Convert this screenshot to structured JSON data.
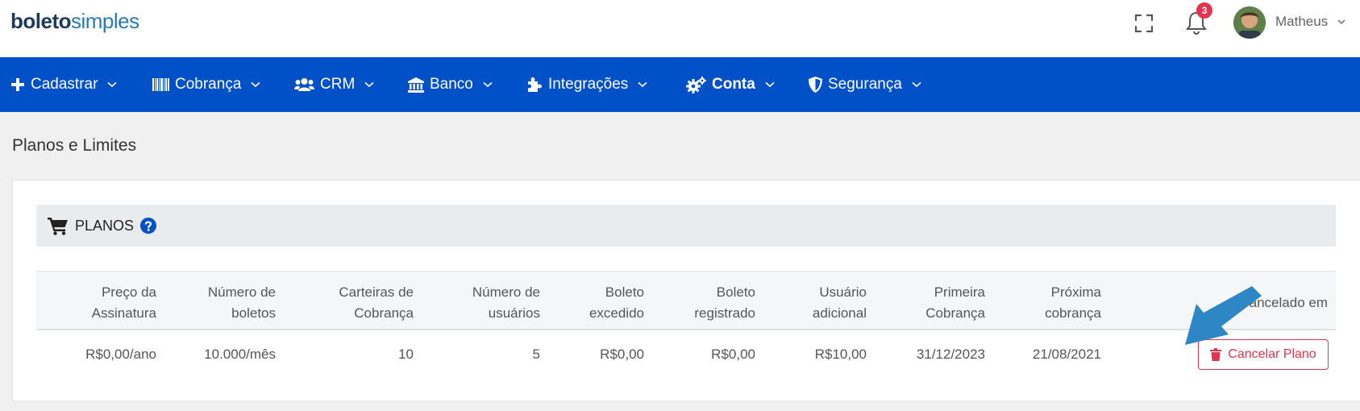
{
  "header": {
    "logo_bold": "boleto",
    "logo_light": "simples",
    "notification_count": "3",
    "user_name": "Matheus"
  },
  "nav": {
    "items": [
      {
        "label": "Cadastrar",
        "icon": "plus-icon"
      },
      {
        "label": "Cobrança",
        "icon": "barcode-icon"
      },
      {
        "label": "CRM",
        "icon": "users-icon"
      },
      {
        "label": "Banco",
        "icon": "bank-icon"
      },
      {
        "label": "Integrações",
        "icon": "puzzle-icon"
      },
      {
        "label": "Conta",
        "icon": "gears-icon",
        "active": true
      },
      {
        "label": "Segurança",
        "icon": "shield-icon"
      }
    ]
  },
  "page": {
    "title": "Planos e Limites"
  },
  "plans": {
    "title": "PLANOS",
    "columns": [
      [
        "Preço da",
        "Assinatura"
      ],
      [
        "Número de",
        "boletos"
      ],
      [
        "Carteiras de",
        "Cobrança"
      ],
      [
        "Número de",
        "usuários"
      ],
      [
        "Boleto",
        "excedido"
      ],
      [
        "Boleto",
        "registrado"
      ],
      [
        "Usuário",
        "adicional"
      ],
      [
        "Primeira",
        "Cobrança"
      ],
      [
        "Próxima",
        "cobrança"
      ],
      [
        "Cancelado em"
      ]
    ],
    "row": [
      "R$0,00/ano",
      "10.000/mês",
      "10",
      "5",
      "R$0,00",
      "R$0,00",
      "R$10,00",
      "31/12/2023",
      "21/08/2021"
    ],
    "cancel_label": "Cancelar Plano"
  },
  "colors": {
    "nav_blue": "#0051c7",
    "danger": "#e3344e",
    "annotation_arrow": "#2f86c4"
  }
}
